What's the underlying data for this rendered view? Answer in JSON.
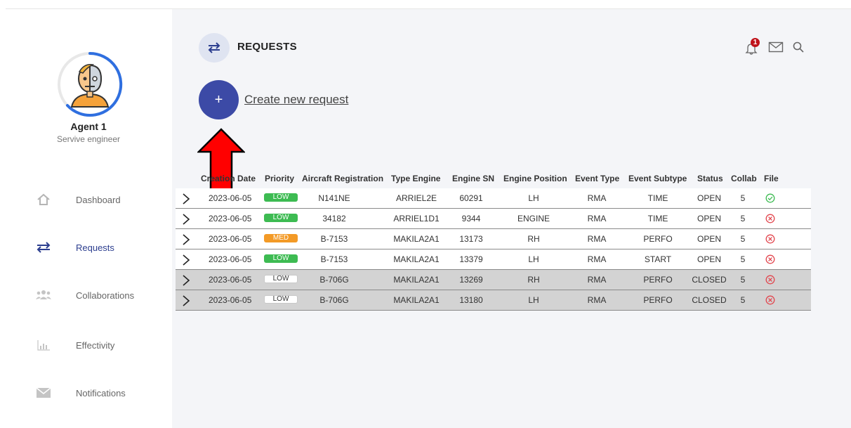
{
  "profile": {
    "name": "Agent 1",
    "role": "Servive engineer"
  },
  "nav": [
    {
      "label": "Dashboard",
      "icon": "home-icon",
      "active": false
    },
    {
      "label": "Requests",
      "icon": "swap-arrows-icon",
      "active": true
    },
    {
      "label": "Collaborations",
      "icon": "users-icon",
      "active": false
    },
    {
      "label": "Effectivity",
      "icon": "bar-chart-icon",
      "active": false
    },
    {
      "label": "Notifications",
      "icon": "envelope-icon",
      "active": false
    }
  ],
  "header": {
    "title": "REQUESTS",
    "notification_count": "1"
  },
  "create": {
    "button_label": "+",
    "link_label": "Create new request"
  },
  "table": {
    "columns": [
      "Creation Date",
      "Priority",
      "Aircraft Registration",
      "Type Engine",
      "Engine SN",
      "Engine Position",
      "Event Type",
      "Event Subtype",
      "Status",
      "Collab",
      "File"
    ],
    "rows": [
      {
        "date": "2023-06-05",
        "priority": "LOW",
        "priority_style": "low",
        "registration": "N141NE",
        "type_engine": "ARRIEL2E",
        "engine_sn": "60291",
        "position": "LH",
        "event_type": "RMA",
        "event_subtype": "TIME",
        "status": "OPEN",
        "collab": "5",
        "file": "ok",
        "shade": "light"
      },
      {
        "date": "2023-06-05",
        "priority": "LOW",
        "priority_style": "low",
        "registration": "34182",
        "type_engine": "ARRIEL1D1",
        "engine_sn": "9344",
        "position": "ENGINE",
        "event_type": "RMA",
        "event_subtype": "TIME",
        "status": "OPEN",
        "collab": "5",
        "file": "missing",
        "shade": "light"
      },
      {
        "date": "2023-06-05",
        "priority": "MED",
        "priority_style": "med",
        "registration": "B-7153",
        "type_engine": "MAKILA2A1",
        "engine_sn": "13173",
        "position": "RH",
        "event_type": "RMA",
        "event_subtype": "PERFO",
        "status": "OPEN",
        "collab": "5",
        "file": "missing",
        "shade": "light"
      },
      {
        "date": "2023-06-05",
        "priority": "LOW",
        "priority_style": "low",
        "registration": "B-7153",
        "type_engine": "MAKILA2A1",
        "engine_sn": "13379",
        "position": "LH",
        "event_type": "RMA",
        "event_subtype": "START",
        "status": "OPEN",
        "collab": "5",
        "file": "missing",
        "shade": "light"
      },
      {
        "date": "2023-06-05",
        "priority": "LOW",
        "priority_style": "plain",
        "registration": "B-706G",
        "type_engine": "MAKILA2A1",
        "engine_sn": "13269",
        "position": "RH",
        "event_type": "RMA",
        "event_subtype": "PERFO",
        "status": "CLOSED",
        "collab": "5",
        "file": "missing",
        "shade": "gray"
      },
      {
        "date": "2023-06-05",
        "priority": "LOW",
        "priority_style": "plain",
        "registration": "B-706G",
        "type_engine": "MAKILA2A1",
        "engine_sn": "13180",
        "position": "LH",
        "event_type": "RMA",
        "event_subtype": "PERFO",
        "status": "CLOSED",
        "collab": "5",
        "file": "missing",
        "shade": "gray"
      }
    ]
  },
  "colors": {
    "accent": "#3c4aa6",
    "low": "#3dbb52",
    "med": "#f39a26",
    "closed_row": "#d3d3d3",
    "error": "#e2474f",
    "ok": "#3dbb52",
    "annotation_arrow": "#ff0000"
  }
}
